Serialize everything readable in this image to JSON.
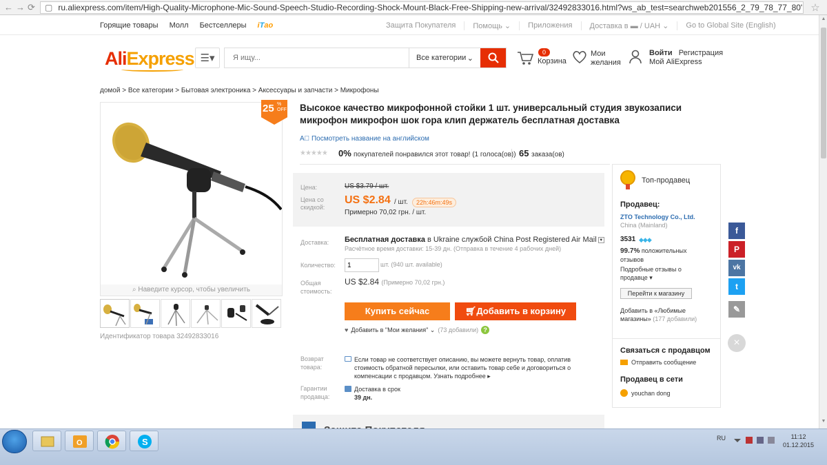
{
  "browser": {
    "url": "ru.aliexpress.com/item/High-Quality-Microphone-Mic-Sound-Speech-Studio-Recording-Shock-Mount-Black-Free-Shipping-new-arrival/32492833016.html?ws_ab_test=searchweb201556_2_79_78_77_80'"
  },
  "topnav": {
    "left": [
      "Горящие товары",
      "Молл",
      "Бестселлеры"
    ],
    "itao": "iTao",
    "right": [
      "Защита Покупателя",
      "Помощь ⌄",
      "Приложения",
      "Доставка в ▬ / UAH ⌄",
      "Go to Global Site (English)"
    ]
  },
  "header": {
    "logo_main": "Ali",
    "logo_accent": "Express",
    "search_placeholder": "Я ищу...",
    "category": "Все категории",
    "cart_count": "0",
    "cart_label": "Корзина",
    "wish_label_1": "Мои",
    "wish_label_2": "желания",
    "login": "Войти",
    "register": "Регистрация",
    "my_ali": "Мой AliExpress"
  },
  "breadcrumb": "домой > Все категории > Бытовая электроника > Аксессуары и запчасти > Микрофоны",
  "gallery": {
    "discount": "25",
    "discount_pct": "%",
    "discount_off": "OFF",
    "zoom_hint": "Наведите курсор, чтобы увеличить",
    "product_id": "Идентификатор товара 32492833016"
  },
  "product": {
    "title": "Высокое качество микрофонной стойки 1 шт. универсальный студия звукозаписи микрофон микрофон шок гора клип держатель бесплатная доставка",
    "translate_link": "Посмотреть название на английском",
    "rating_pct": "0%",
    "rating_text": "покупателей понравился этот товар! (1 голоса(ов))",
    "orders": "65",
    "orders_text": "заказа(ов)"
  },
  "price": {
    "label_price": "Цена:",
    "old": "US $3.79 / шт.",
    "label_discount_1": "Цена со",
    "label_discount_2": "скидкой:",
    "new": "US $2.84",
    "unit": "/ шт.",
    "timer": "22h:46m:49s",
    "approx": "Примерно 70,02 грн. / шт."
  },
  "shipping": {
    "label": "Доставка:",
    "method_bold": "Бесплатная доставка",
    "method_rest": " в Ukraine службой China Post Registered Air Mail",
    "estimate": "Расчётное время доставки: 15-39 дн. (Отправка в течение 4 рабочих дней)"
  },
  "quantity": {
    "label": "Количество:",
    "value": "1",
    "info": "шт. (940 шт. available)"
  },
  "total": {
    "label_1": "Общая",
    "label_2": "стоимость:",
    "value": "US $2.84",
    "approx": "(Примерно 70,02 грн.)"
  },
  "actions": {
    "buy": "Купить сейчас",
    "add_cart": "Добавить в корзину",
    "wish": "Добавить в \"Мои желания\" ⌄",
    "wish_count": "(73 добавили)",
    "help": "?"
  },
  "returns": {
    "label_1": "Возврат",
    "label_2": "товара:",
    "text": "Если товар не соответствует описанию, вы можете вернуть товар, оплатив стоимость обратной пересылки, или оставить товар себе и договориться о компенсации с продавцом.",
    "more": "Узнать подробнее ▸"
  },
  "guarantee": {
    "label_1": "Гарантии",
    "label_2": "продавца:",
    "line1": "Доставка в срок",
    "line2": "39 дн."
  },
  "protection": {
    "title": "Защита Покупателя"
  },
  "seller": {
    "badge": "Топ-продавец",
    "heading": "Продавец:",
    "name": "ZTO Technology Co., Ltd.",
    "country": "China (Mainland)",
    "score": "3531",
    "diamonds": "◆◆◆",
    "positive_pct": "99.7%",
    "positive_text": "положительных отзывов",
    "detailed": "Подробные отзывы о продавце ▾",
    "store_btn": "Перейти к магазину",
    "fav_text": "Добавить в «Любимые магазины»",
    "fav_count": "(177 добавили)",
    "contact_heading": "Связаться с продавцом",
    "send_msg": "Отправить сообщение",
    "online_heading": "Продавец в сети",
    "online_user": "youchan dong"
  },
  "social": {
    "fb": "f",
    "pin": "P",
    "vk": "vk",
    "tw": "t",
    "edit": "✎",
    "close": "×"
  },
  "taskbar": {
    "lang": "RU",
    "time": "11:12",
    "date": "01.12.2015"
  },
  "colors": {
    "brand_red": "#e62e04",
    "brand_orange": "#f5a000",
    "buy_orange": "#f67d1b",
    "cart_red": "#f04b0f",
    "link_blue": "#2c6cb0",
    "fb": "#3b5998",
    "pinterest": "#cb2027",
    "vk": "#4c75a3",
    "twitter": "#1da1f2"
  }
}
